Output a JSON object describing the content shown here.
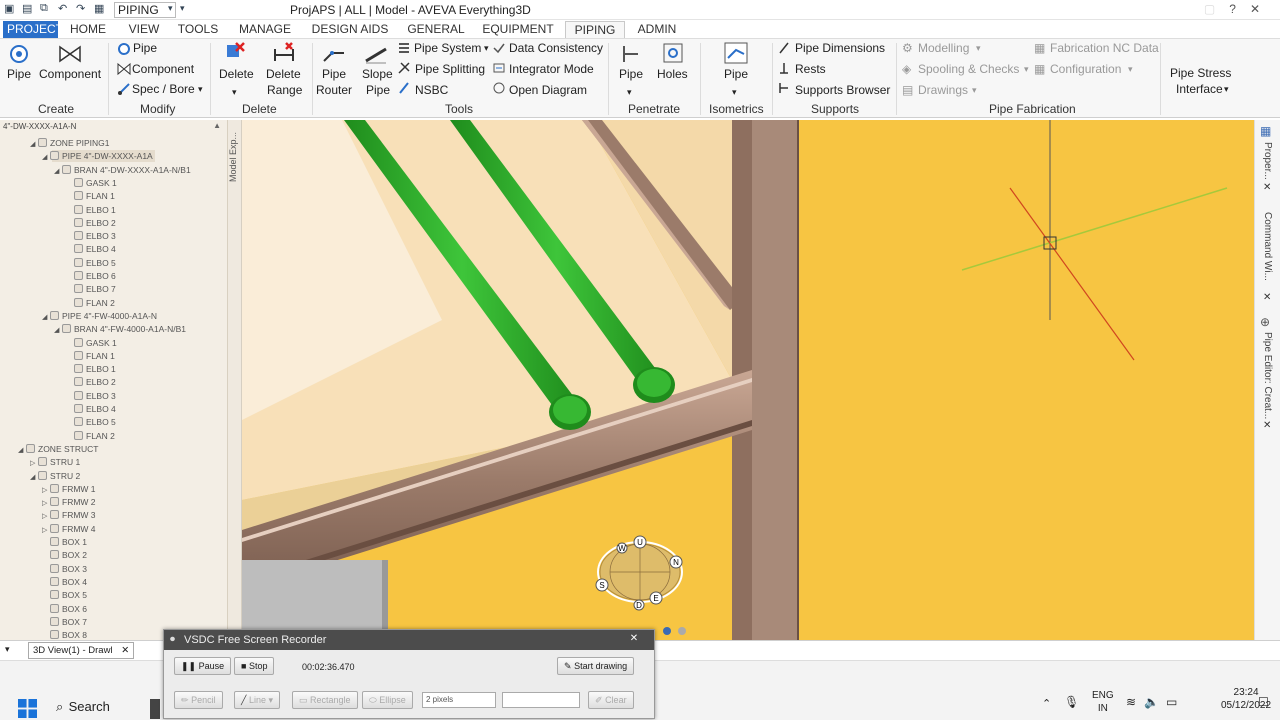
{
  "titlebar": {
    "context_combo": "PIPING",
    "app_title": "ProjAPS | ALL | Model - AVEVA Everything3D"
  },
  "tabs": [
    "PROJECT",
    "HOME",
    "VIEW",
    "TOOLS",
    "MANAGE",
    "DESIGN AIDS",
    "GENERAL",
    "EQUIPMENT",
    "PIPING",
    "ADMIN"
  ],
  "active_tab": "PIPING",
  "ribbon": {
    "create": {
      "pipe": "Pipe",
      "component": "Component",
      "group": "Create"
    },
    "modify": {
      "pipe": "Pipe",
      "component": "Component",
      "spec_bore": "Spec / Bore",
      "group": "Modify"
    },
    "delete": {
      "delete": "Delete",
      "delete_range_1": "Delete",
      "delete_range_2": "Range",
      "group": "Delete"
    },
    "tools": {
      "router_1": "Pipe",
      "router_2": "Router",
      "slope_1": "Slope",
      "slope_2": "Pipe",
      "pipe_system": "Pipe System",
      "pipe_splitting": "Pipe Splitting",
      "nsbc": "NSBC",
      "data_consistency": "Data Consistency",
      "integrator_mode": "Integrator Mode",
      "open_diagram": "Open Diagram",
      "group": "Tools"
    },
    "penetrate": {
      "pipe": "Pipe",
      "holes": "Holes",
      "group": "Penetrate"
    },
    "isometrics": {
      "pipe": "Pipe",
      "group": "Isometrics"
    },
    "supports": {
      "pipe_dimensions": "Pipe Dimensions",
      "rests": "Rests",
      "supports_browser": "Supports Browser",
      "group": "Supports"
    },
    "fabrication": {
      "modelling": "Modelling",
      "spooling": "Spooling & Checks",
      "drawings": "Drawings",
      "fabrication_nc": "Fabrication NC Data",
      "configuration": "Configuration",
      "group": "Pipe Fabrication"
    },
    "stress": {
      "line1": "Pipe Stress",
      "line2": "Interface"
    }
  },
  "tree": {
    "header": "4\"-DW-XXXX-A1A-N",
    "side_tab": "Model Exp...",
    "nodes": [
      {
        "label": "ZONE PIPING1",
        "indent": 3,
        "twisty": "◢"
      },
      {
        "label": "PIPE 4\"-DW-XXXX-A1A",
        "indent": 4,
        "twisty": "◢"
      },
      {
        "label": "BRAN 4\"-DW-XXXX-A1A-N/B1",
        "indent": 5,
        "twisty": "◢"
      },
      {
        "label": "GASK 1",
        "indent": 6
      },
      {
        "label": "FLAN 1",
        "indent": 6
      },
      {
        "label": "ELBO 1",
        "indent": 6
      },
      {
        "label": "ELBO 2",
        "indent": 6
      },
      {
        "label": "ELBO 3",
        "indent": 6
      },
      {
        "label": "ELBO 4",
        "indent": 6
      },
      {
        "label": "ELBO 5",
        "indent": 6
      },
      {
        "label": "ELBO 6",
        "indent": 6
      },
      {
        "label": "ELBO 7",
        "indent": 6
      },
      {
        "label": "FLAN 2",
        "indent": 6
      },
      {
        "label": "PIPE 4\"-FW-4000-A1A-N",
        "indent": 4,
        "twisty": "◢"
      },
      {
        "label": "BRAN 4\"-FW-4000-A1A-N/B1",
        "indent": 5,
        "twisty": "◢"
      },
      {
        "label": "GASK 1",
        "indent": 6
      },
      {
        "label": "FLAN 1",
        "indent": 6
      },
      {
        "label": "ELBO 1",
        "indent": 6
      },
      {
        "label": "ELBO 2",
        "indent": 6
      },
      {
        "label": "ELBO 3",
        "indent": 6
      },
      {
        "label": "ELBO 4",
        "indent": 6
      },
      {
        "label": "ELBO 5",
        "indent": 6
      },
      {
        "label": "FLAN 2",
        "indent": 6
      },
      {
        "label": "ZONE STRUCT",
        "indent": 2,
        "twisty": "◢"
      },
      {
        "label": "STRU 1",
        "indent": 3,
        "twisty": "▷"
      },
      {
        "label": "STRU 2",
        "indent": 3,
        "twisty": "◢"
      },
      {
        "label": "FRMW 1",
        "indent": 4,
        "twisty": "▷"
      },
      {
        "label": "FRMW 2",
        "indent": 4,
        "twisty": "▷"
      },
      {
        "label": "FRMW 3",
        "indent": 4,
        "twisty": "▷"
      },
      {
        "label": "FRMW 4",
        "indent": 4,
        "twisty": "▷"
      },
      {
        "label": "BOX 1",
        "indent": 4
      },
      {
        "label": "BOX 2",
        "indent": 4
      },
      {
        "label": "BOX 3",
        "indent": 4
      },
      {
        "label": "BOX 4",
        "indent": 4
      },
      {
        "label": "BOX 5",
        "indent": 4
      },
      {
        "label": "BOX 6",
        "indent": 4
      },
      {
        "label": "BOX 7",
        "indent": 4
      },
      {
        "label": "BOX 8",
        "indent": 4
      }
    ]
  },
  "view": {
    "compass": {
      "u": "U",
      "d": "D",
      "n": "N",
      "s": "S",
      "e": "E",
      "w": "W"
    },
    "tab_label": "3D View(1) - Drawl"
  },
  "right_panels": [
    "Proper...",
    "Command Wi...",
    "Pipe Editor: Creat..."
  ],
  "recorder": {
    "title": "VSDC Free Screen Recorder",
    "pause": "Pause",
    "stop": "Stop",
    "time": "00:02:36.470",
    "start_drawing": "Start drawing",
    "pencil": "Pencil",
    "line": "Line",
    "rectangle": "Rectangle",
    "ellipse": "Ellipse",
    "pixels": "2 pixels",
    "clear": "Clear"
  },
  "taskbar": {
    "search": "Search",
    "lang1": "ENG",
    "lang2": "IN",
    "time": "23:24",
    "date": "05/12/2022"
  },
  "colors": {
    "accent": "#2a6fc9",
    "background_yellow": "#f7c542",
    "pipe_green": "#2fae2b",
    "steel_brown": "#9b7b6a"
  }
}
